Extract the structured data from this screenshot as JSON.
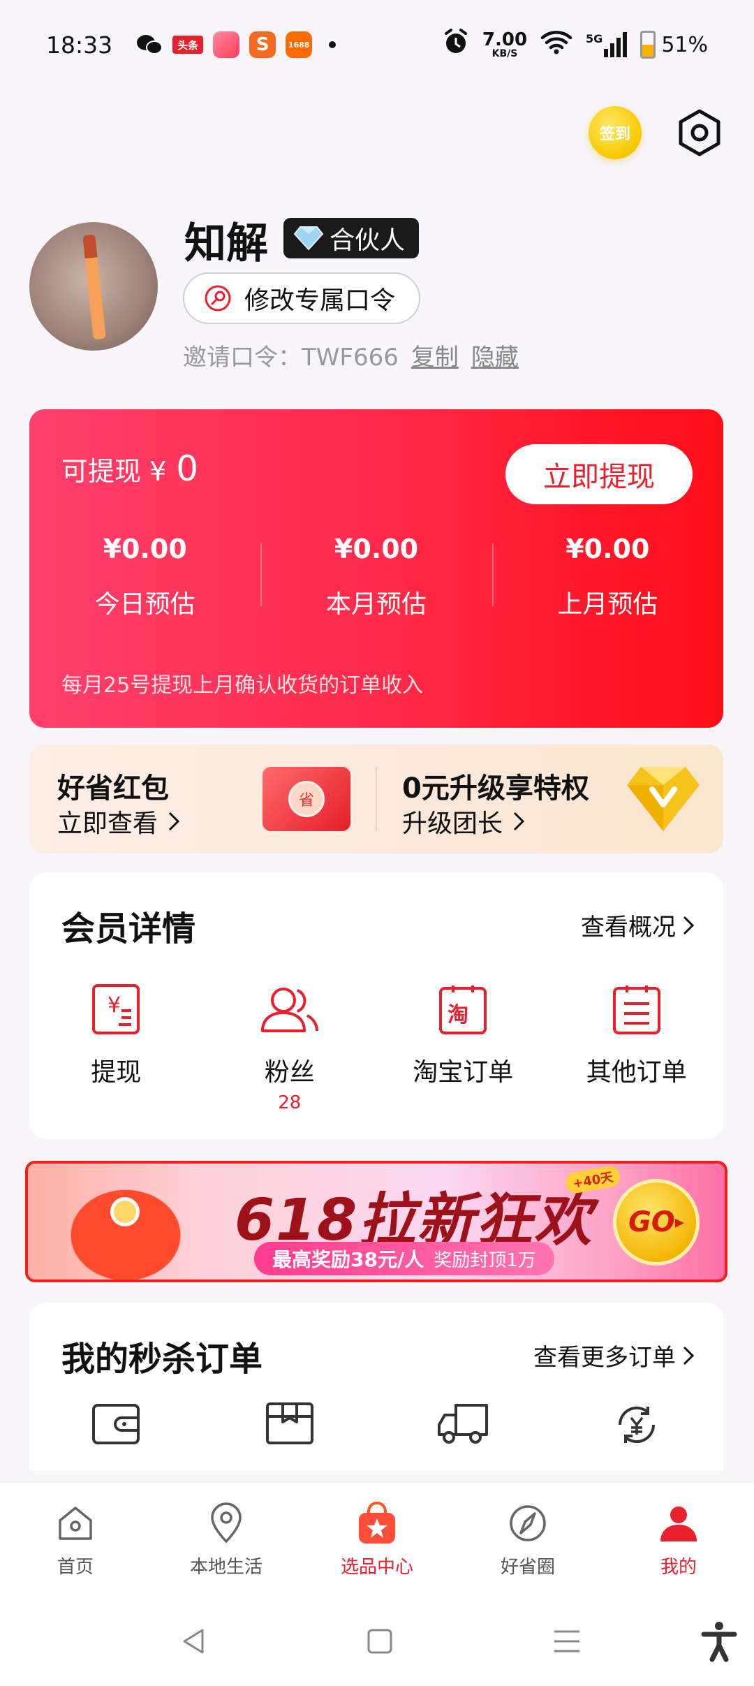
{
  "status_bar": {
    "time": "18:33",
    "apps": [
      {
        "name": "wechat-icon",
        "label": "",
        "color": "#111111"
      },
      {
        "name": "toutiao-icon",
        "label": "头条",
        "color": "#e8202e"
      },
      {
        "name": "game-app-icon",
        "label": "",
        "color": "#ff5a7a"
      },
      {
        "name": "sogou-icon",
        "label": "S",
        "color": "#f46a20"
      },
      {
        "name": "app-1688-icon",
        "label": "1688",
        "color": "#ff6a00"
      }
    ],
    "net_speed": "7.00",
    "net_unit": "KB/S",
    "network": "5G",
    "battery": "51%",
    "battery_level": 0.51
  },
  "header": {
    "signin_label": "签到"
  },
  "profile": {
    "username": "知解",
    "badge_label": "合伙人",
    "change_code_label": "修改专属口令",
    "invite_label": "邀请口令：TWF666",
    "copy_label": "复制",
    "hide_label": "隐藏"
  },
  "earnings": {
    "withdrawable_label": "可提现 ¥",
    "withdrawable_amount": "0",
    "withdraw_button": "立即提现",
    "stats": [
      {
        "value": "¥0.00",
        "label": "今日预估"
      },
      {
        "value": "¥0.00",
        "label": "本月预估"
      },
      {
        "value": "¥0.00",
        "label": "上月预估"
      }
    ],
    "note": "每月25号提现上月确认收货的订单收入"
  },
  "promo": {
    "left_title": "好省红包",
    "left_sub": "立即查看",
    "redpack_char": "省",
    "right_title": "0元升级享特权",
    "right_sub": "升级团长"
  },
  "member": {
    "title": "会员详情",
    "more_label": "查看概况",
    "items": [
      {
        "label": "提现",
        "count": ""
      },
      {
        "label": "粉丝",
        "count": "28"
      },
      {
        "label": "淘宝订单",
        "count": ""
      },
      {
        "label": "其他订单",
        "count": ""
      }
    ]
  },
  "banner": {
    "title": "618拉新狂欢",
    "sub_bold": "最高奖励38元/人",
    "sub_rest": "奖励封顶1万",
    "tag": "+40天",
    "go_label": "GO"
  },
  "seckill": {
    "title": "我的秒杀订单",
    "more_label": "查看更多订单"
  },
  "tabbar": {
    "tabs": [
      {
        "label": "首页",
        "icon": "home-icon"
      },
      {
        "label": "本地生活",
        "icon": "location-icon"
      },
      {
        "label": "选品中心",
        "icon": "shopping-bag-star-icon"
      },
      {
        "label": "好省圈",
        "icon": "compass-icon"
      },
      {
        "label": "我的",
        "icon": "person-icon"
      }
    ],
    "active_index": 4
  },
  "colors": {
    "accent": "#e8202e",
    "card_gradient_start": "#ff3f6c",
    "card_gradient_end": "#ff0c17"
  }
}
